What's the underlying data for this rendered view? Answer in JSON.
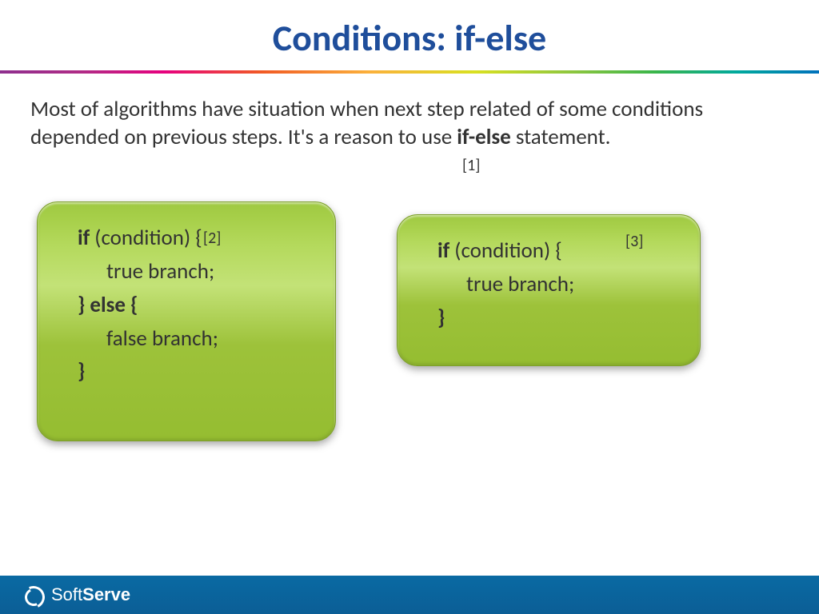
{
  "title": "Conditions: if-else",
  "paragraph": {
    "pre": "Most of algorithms have situation when next step related of some conditions depended on previous steps. It's a reason to use ",
    "bold": "if-else",
    "post": " statement."
  },
  "refs": {
    "r1": "[1]",
    "r2": "[2]",
    "r3": "[3]"
  },
  "code_left": {
    "l1_kw": "if",
    "l1_rest": " (condition) {",
    "l2": "true branch;",
    "l3_close": "}",
    "l3_kw": " else ",
    "l3_open": "{",
    "l4": "false branch;",
    "l5": "}"
  },
  "code_right": {
    "l1_kw": "if",
    "l1_rest": " (condition) {",
    "l2": "true branch;",
    "l3": "}"
  },
  "footer": {
    "brand_a": "Soft",
    "brand_b": "Serve"
  }
}
